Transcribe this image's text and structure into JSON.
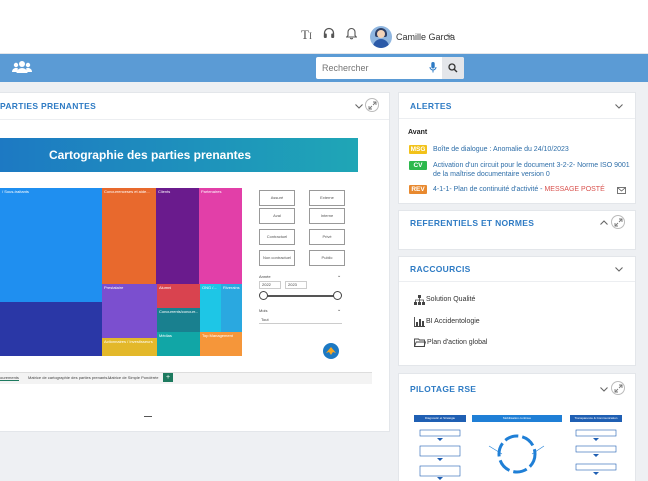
{
  "header": {
    "user_name": "Camille Garcia",
    "icons": [
      "text-size-icon",
      "headset-icon",
      "bell-icon",
      "avatar",
      "chevron-down-icon"
    ]
  },
  "toolbar": {
    "search_placeholder": "Rechercher"
  },
  "panels": {
    "stakeholders": {
      "title": "PARTIES PRENANTES",
      "report_title": "Cartographie des parties prenantes",
      "treemap": [
        {
          "label": "/ Sous-traitants",
          "value": "",
          "color": "#1f8ff0"
        },
        {
          "label": "Concurrenceses et aide...",
          "value": "",
          "color": "#e8692d"
        },
        {
          "label": "Clients",
          "value": "",
          "color": "#6a1b8d"
        },
        {
          "label": "Partenaires",
          "value": "",
          "color": "#e23fa8"
        },
        {
          "label": "Prestataire",
          "value": "",
          "color": "#7b4fcf"
        },
        {
          "label": "Alumni",
          "value": "",
          "color": "#d9434f"
        },
        {
          "label": "ONG /...",
          "value": "",
          "color": "#1ec6e6"
        },
        {
          "label": "Riverains",
          "value": "",
          "color": "#2aa8e0"
        },
        {
          "label": "Concurrents/concurr...",
          "value": "",
          "color": "#19808f"
        },
        {
          "label": "Médias",
          "value": "",
          "color": "#11a6a6"
        },
        {
          "label": "Actionnaires / Investisseurs",
          "value": "",
          "color": "#e3b82a"
        },
        {
          "label": "Top Management",
          "value": "",
          "color": "#f5963a"
        }
      ],
      "slicers": [
        "Assuré",
        "Externe",
        "Aval",
        "Interne",
        "Contractuel",
        "Privé",
        "Non contractuel",
        "Public"
      ],
      "year_label": "Année",
      "year_from": "2022",
      "year_to": "2023",
      "month_label": "Mois",
      "month_value": "Tout",
      "tabs": [
        "ourements",
        "Matrice de cartographie des parties prenants...",
        "Matrice de Simple Pondérée"
      ],
      "tab_add": "+",
      "page_marker": "—"
    },
    "alerts": {
      "title": "ALERTES",
      "subtitle": "Avant",
      "items": [
        {
          "badge": "MSG",
          "badge_color": "#f2c21a",
          "text": "Boîte de dialogue : Anomalie du 24/10/2023",
          "extra": ""
        },
        {
          "badge": "CV",
          "badge_color": "#2db84d",
          "text": "Activation d'un circuit pour le document 3-2-2- Norme ISO 9001",
          "text2": "de la maîtrise documentaire version 0",
          "extra": ""
        },
        {
          "badge": "REV",
          "badge_color": "#e8892f",
          "text": "4-1-1- Plan de continuité d'activité - ",
          "extra": "MESSAGE POSTÉ"
        }
      ]
    },
    "standards": {
      "title": "REFERENTIELS ET NORMES"
    },
    "shortcuts": {
      "title": "RACCOURCIS",
      "items": [
        {
          "label": "Solution Qualité",
          "icon": "hierarchy-icon"
        },
        {
          "label": "BI Accidentologie",
          "icon": "bar-chart-icon"
        },
        {
          "label": "Plan d'action global",
          "icon": "folder-icon"
        }
      ]
    },
    "rse": {
      "title": "PILOTAGE RSE",
      "flow_headers": [
        "Diagnostic et Stratégie",
        "Mobilisation continue",
        "Transparence & Communication"
      ]
    }
  }
}
